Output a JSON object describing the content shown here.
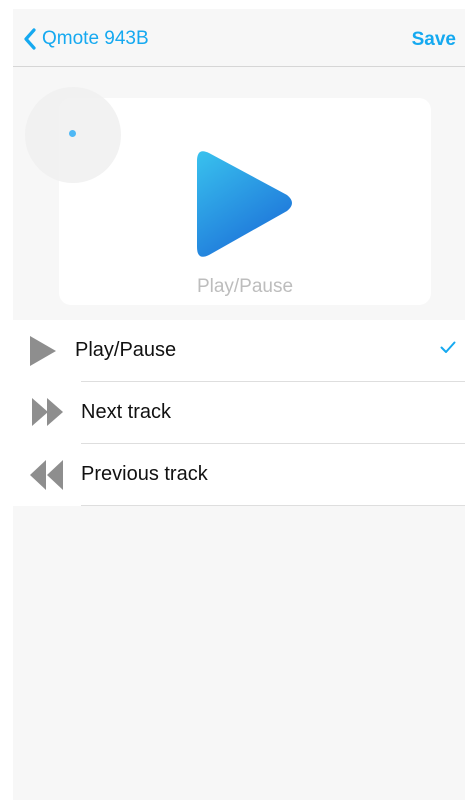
{
  "navbar": {
    "back_label": "Qmote 943B",
    "save_label": "Save"
  },
  "preview": {
    "label": "Play/Pause",
    "icon": "play-icon"
  },
  "actions": [
    {
      "label": "Play/Pause",
      "icon": "play-icon",
      "selected": true
    },
    {
      "label": "Next track",
      "icon": "fast-forward-icon",
      "selected": false
    },
    {
      "label": "Previous track",
      "icon": "rewind-icon",
      "selected": false
    }
  ],
  "colors": {
    "accent": "#15a9f0",
    "icon_gray": "#8e8e8e",
    "play_gradient_start": "#39c2ee",
    "play_gradient_end": "#1d72d9"
  }
}
